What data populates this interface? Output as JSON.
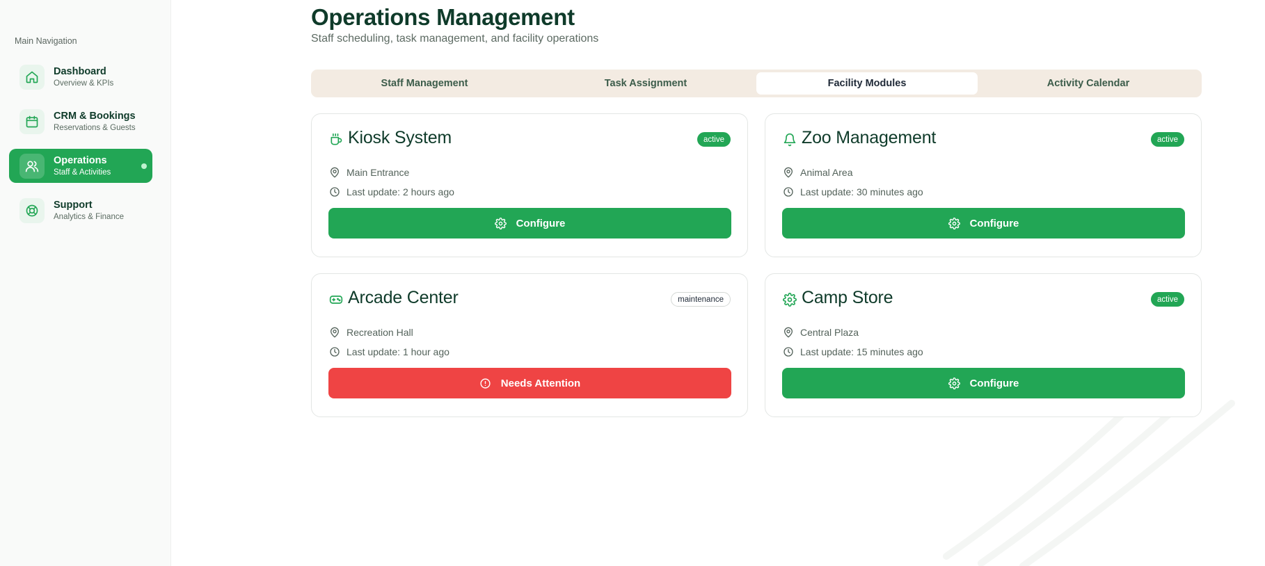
{
  "sidebar": {
    "heading": "Main Navigation",
    "items": [
      {
        "label": "Dashboard",
        "sub": "Overview & KPIs",
        "icon": "home-icon"
      },
      {
        "label": "CRM & Bookings",
        "sub": "Reservations & Guests",
        "icon": "calendar-icon"
      },
      {
        "label": "Operations",
        "sub": "Staff & Activities",
        "icon": "users-icon",
        "active": true
      },
      {
        "label": "Support",
        "sub": "Analytics & Finance",
        "icon": "lifebuoy-icon"
      }
    ]
  },
  "header": {
    "title": "Operations Management",
    "subtitle": "Staff scheduling, task management, and facility operations"
  },
  "tabs": [
    {
      "label": "Staff Management"
    },
    {
      "label": "Task Assignment"
    },
    {
      "label": "Facility Modules",
      "active": true
    },
    {
      "label": "Activity Calendar"
    }
  ],
  "cards": [
    {
      "title": "Kiosk System",
      "icon": "coffee-icon",
      "status": "active",
      "location": "Main Entrance",
      "updated": "Last update: 2 hours ago",
      "button": "Configure",
      "button_icon": "gear-icon"
    },
    {
      "title": "Zoo Management",
      "icon": "bell-icon",
      "status": "active",
      "location": "Animal Area",
      "updated": "Last update: 30 minutes ago",
      "button": "Configure",
      "button_icon": "gear-icon"
    },
    {
      "title": "Arcade Center",
      "icon": "gamepad-icon",
      "status": "maintenance",
      "location": "Recreation Hall",
      "updated": "Last update: 1 hour ago",
      "button": "Needs Attention",
      "button_icon": "alert-circle-icon"
    },
    {
      "title": "Camp Store",
      "icon": "gear-icon",
      "status": "active",
      "location": "Central Plaza",
      "updated": "Last update: 15 minutes ago",
      "button": "Configure",
      "button_icon": "gear-icon"
    }
  ],
  "colors": {
    "accent": "#22a655",
    "danger": "#ef4444",
    "title": "#0f3b2a",
    "tab_bg": "#f3ebe2"
  }
}
